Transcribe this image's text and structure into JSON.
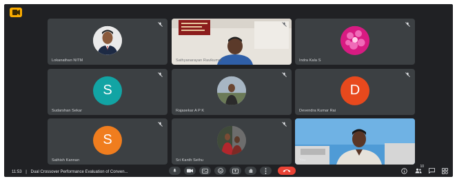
{
  "colors": {
    "background": "#202124",
    "tile": "#3c4043",
    "accent_end_call": "#ea4335",
    "avatar_s_teal": "#12a4a4",
    "avatar_d_red": "#e8491d",
    "avatar_s_orange": "#f07d1e",
    "app_badge": "#f9ab00"
  },
  "tiles": [
    {
      "name": "Lokanathan NITM",
      "avatar_type": "photo"
    },
    {
      "name": "Sathyanarayan Ravikumar",
      "avatar_type": "video"
    },
    {
      "name": "Indra Kala S",
      "avatar_type": "flower-photo"
    },
    {
      "name": "Sudarshan Sekar",
      "avatar_type": "letter",
      "letter": "S"
    },
    {
      "name": "Rajasekar A P K",
      "avatar_type": "photo"
    },
    {
      "name": "Devendra Kumar Rai",
      "avatar_type": "letter",
      "letter": "D"
    },
    {
      "name": "Sathish Kannan",
      "avatar_type": "letter",
      "letter": "S"
    },
    {
      "name": "Sri Kanth Sethu",
      "avatar_type": "photo"
    },
    {
      "name": "You",
      "avatar_type": "self-video"
    }
  ],
  "bottom_bar": {
    "time": "11:53",
    "meeting_title": "Dual Crossover Performance Evaluation of Conven..."
  },
  "controls": {
    "center": [
      "mic-icon",
      "camera-icon",
      "captions-icon",
      "emoji-icon",
      "present-icon",
      "more-icon",
      "end-call-icon"
    ],
    "right": [
      "info-icon",
      "people-icon",
      "chat-icon",
      "activities-icon"
    ],
    "people_count": "10"
  }
}
